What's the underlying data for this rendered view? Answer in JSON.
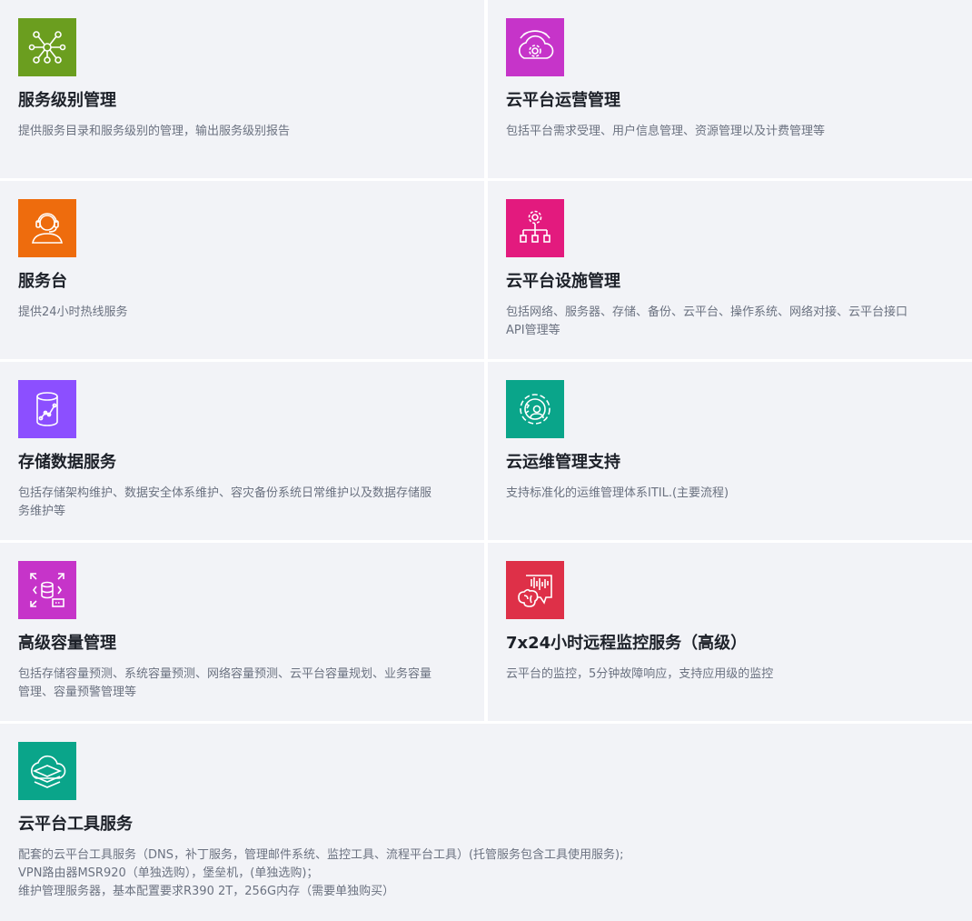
{
  "cards": [
    {
      "title": "服务级别管理",
      "desc": [
        "提供服务目录和服务级别的管理，输出服务级别报告"
      ],
      "icon": "network-nodes-icon",
      "color": "#6b9e1f"
    },
    {
      "title": "云平台运营管理",
      "desc": [
        "包括平台需求受理、用户信息管理、资源管理以及计费管理等"
      ],
      "icon": "cloud-gear-icon",
      "color": "#c634c9"
    },
    {
      "title": "服务台",
      "desc": [
        "提供24小时热线服务"
      ],
      "icon": "headset-agent-icon",
      "color": "#ee6c0d"
    },
    {
      "title": "云平台设施管理",
      "desc": [
        "包括网络、服务器、存储、备份、云平台、操作系统、网络对接、云平台接口",
        "API管理等"
      ],
      "icon": "gear-hierarchy-icon",
      "color": "#e31a7e"
    },
    {
      "title": "存储数据服务",
      "desc": [
        "包括存储架构维护、数据安全体系维护、容灾备份系统日常维护以及数据存储服",
        "务维护等"
      ],
      "icon": "database-chart-icon",
      "color": "#8c4fff"
    },
    {
      "title": "云运维管理支持",
      "desc": [
        "支持标准化的运维管理体系ITIL.(主要流程)"
      ],
      "icon": "gear-user-icon",
      "color": "#0aa58a"
    },
    {
      "title": "高级容量管理",
      "desc": [
        "包括存储容量预测、系统容量预测、网络容量预测、云平台容量规划、业务容量",
        "管理、容量预警管理等"
      ],
      "icon": "database-scale-icon",
      "color": "#c634c9"
    },
    {
      "title": "7x24小时远程监控服务（高级）",
      "desc": [
        "云平台的监控，5分钟故障响应，支持应用级的监控"
      ],
      "icon": "brain-monitor-icon",
      "color": "#de3048"
    },
    {
      "title": "云平台工具服务",
      "desc": [
        "配套的云平台工具服务（DNS，补丁服务，管理邮件系统、监控工具、流程平台工具）(托管服务包含工具使用服务);",
        "VPN路由器MSR920（单独选购），堡垒机，(单独选购)；",
        "维护管理服务器，基本配置要求R390 2T，256G内存（需要单独购买）"
      ],
      "icon": "cloud-layers-icon",
      "color": "#0aa58a"
    }
  ]
}
